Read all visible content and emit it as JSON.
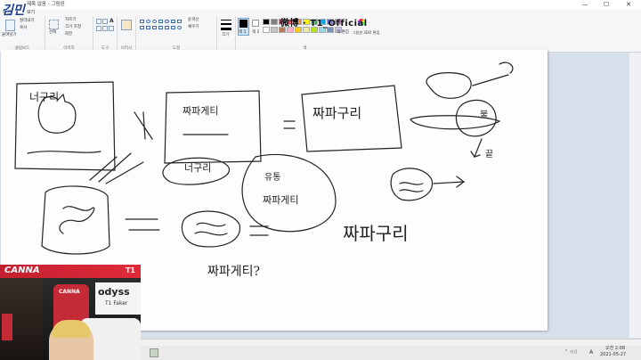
{
  "window": {
    "title": "제목 없음 - 그림판",
    "min_label": "—",
    "max_label": "☐",
    "close_label": "✕"
  },
  "menu": {
    "items": [
      "파일",
      "보기"
    ]
  },
  "ribbon": {
    "groups": {
      "clipboard": {
        "label": "클립보드",
        "paste": "붙여넣기",
        "cut": "잘라내기",
        "copy": "복사"
      },
      "image": {
        "label": "이미지",
        "select": "선택",
        "crop": "자르기",
        "resize": "크기 조정",
        "rotate": "회전"
      },
      "tools": {
        "label": "도구",
        "text_glyph": "A"
      },
      "brushes": {
        "label": "브러시"
      },
      "shapes": {
        "label": "도형",
        "outline": "윤곽선",
        "fill": "채우기"
      },
      "size": {
        "label": "크기"
      },
      "colors": {
        "label": "색",
        "color1": "색 1",
        "color2": "색 2",
        "edit_colors": "색 편집",
        "paint3d": "그림판 3D로 편집"
      }
    },
    "palette": [
      "#000000",
      "#7f7f7f",
      "#880015",
      "#ed1c24",
      "#ff7f27",
      "#fff200",
      "#22b14c",
      "#00a2e8",
      "#3f48cc",
      "#a349a4",
      "#ffffff",
      "#c3c3c3",
      "#b97a57",
      "#ffaec9",
      "#ffc90e",
      "#efe4b0",
      "#b5e61d",
      "#99d9ea",
      "#7092be",
      "#c8bfe7"
    ]
  },
  "canvas_text": {
    "note1": "너구리",
    "note2": "짜파게티",
    "note3": "=",
    "note4": "짜파구리",
    "note5": "너구리",
    "note6": "유통",
    "note7": "짜파게티",
    "note8": "짜파구리",
    "note9": "짜파게티?",
    "note10": "끝",
    "note11": "불"
  },
  "overlay": {
    "watermark": "微博 · T1_Official",
    "logo": "김민"
  },
  "webcam": {
    "banner_name": "CANNA",
    "team_logo": "T1",
    "jersey_text": "CANNA",
    "poster_brand": "odyss",
    "poster_name": "T1 Faker"
  },
  "taskbar": {
    "time": "오전 2:08",
    "date": "2021-05-27",
    "ime": "A"
  }
}
